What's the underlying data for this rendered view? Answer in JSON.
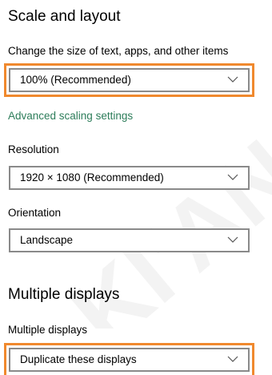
{
  "watermark": {
    "text": "KI'AN NO"
  },
  "scale_layout": {
    "heading": "Scale and layout",
    "size_label": "Change the size of text, apps, and other items",
    "size_value": "100% (Recommended)",
    "advanced_link": "Advanced scaling settings",
    "resolution_label": "Resolution",
    "resolution_value": "1920 × 1080 (Recommended)",
    "orientation_label": "Orientation",
    "orientation_value": "Landscape"
  },
  "multiple_displays": {
    "heading": "Multiple displays",
    "label": "Multiple displays",
    "value": "Duplicate these displays"
  },
  "colors": {
    "highlight": "#f0892e",
    "link": "#2d7d5a",
    "dropdown_border": "#8a8a8a"
  },
  "icons": {
    "dropdown_chevron": "chevron-down-icon"
  }
}
